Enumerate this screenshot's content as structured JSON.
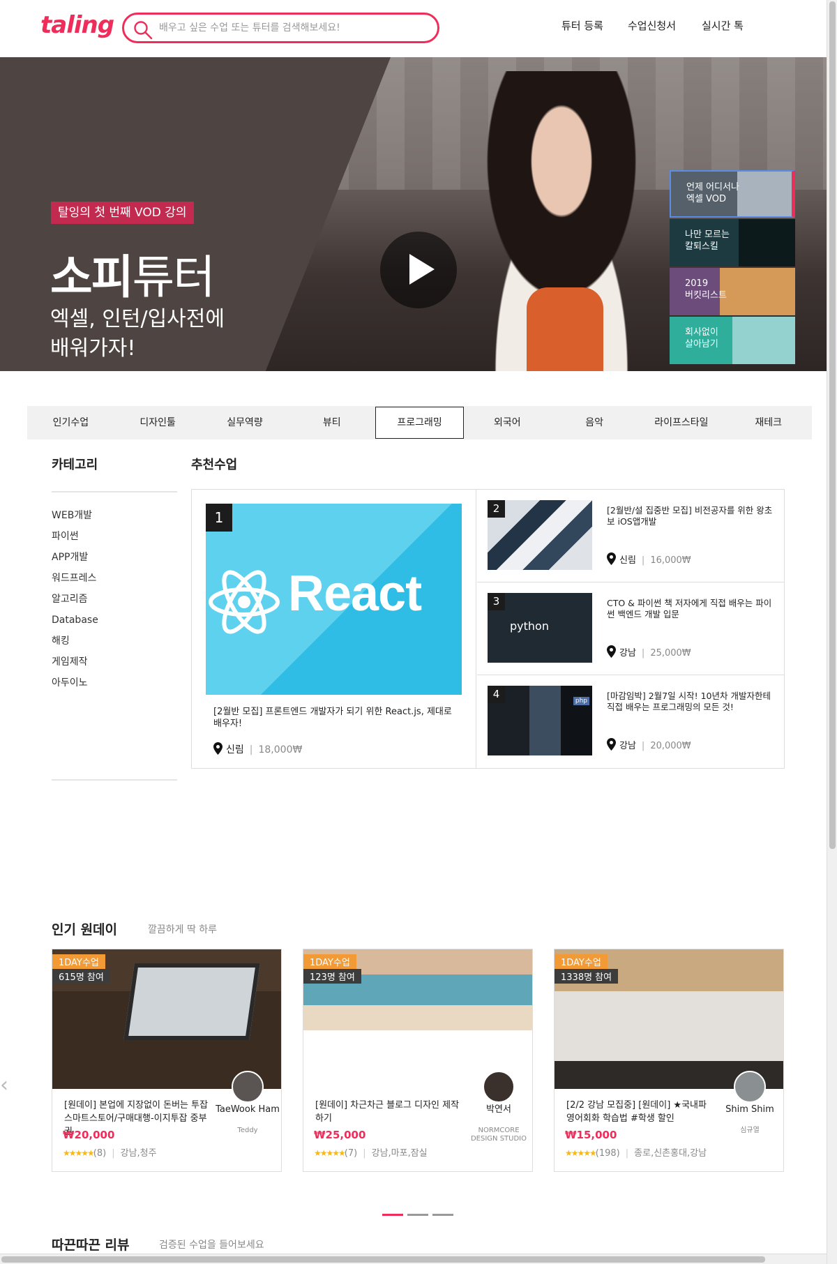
{
  "header": {
    "logo": "taling",
    "search_placeholder": "배우고 싶은 수업 또는 튜터를 검색해보세요!",
    "nav": [
      "튜터 등록",
      "수업신청서",
      "실시간 톡"
    ]
  },
  "hero": {
    "badge": "탈잉의 첫 번째 VOD 강의",
    "title_bold": "소피",
    "title_regular": "튜터",
    "subtitle": "엑셀, 인턴/입사전에\n배워가자!",
    "side_items": [
      "언제 어디서나\n엑셀 VOD",
      "나만 모르는\n칼퇴스킬",
      "2019\n버킷리스트",
      "회사없이\n살아남기"
    ]
  },
  "tabs": [
    "인기수업",
    "디자인툴",
    "실무역량",
    "뷰티",
    "프로그래밍",
    "외국어",
    "음악",
    "라이프스타일",
    "재테크"
  ],
  "active_tab": "프로그래밍",
  "sidebar": {
    "title": "카테고리",
    "items": [
      "WEB개발",
      "파이썬",
      "APP개발",
      "워드프레스",
      "알고리즘",
      "Database",
      "해킹",
      "게임제작",
      "아두이노"
    ]
  },
  "recommended": {
    "title": "추천수업",
    "items": [
      {
        "rank": "1",
        "image_text": "React",
        "title": "[2월반 모집] 프론트엔드 개발자가 되기 위한 React.js, 제대로 배우자!",
        "location": "신림",
        "price": "18,000₩"
      },
      {
        "rank": "2",
        "title": "[2월반/설 집중반 모집] 비전공자를 위한 왕초보 iOS앱개발",
        "location": "신림",
        "price": "16,000₩"
      },
      {
        "rank": "3",
        "image_text": "python",
        "title": "CTO & 파이썬 책 저자에게 직접 배우는 파이썬 백엔드 개발 입문",
        "location": "강남",
        "price": "25,000₩"
      },
      {
        "rank": "4",
        "image_text": "php",
        "title": "[마감임박] 2월7일 시작! 10년차 개발자한테 직접 배우는 프로그래밍의 모든 것!",
        "location": "강남",
        "price": "20,000₩"
      }
    ]
  },
  "popular": {
    "title": "인기 원데이",
    "subtitle": "깔끔하게 딱 하루",
    "cards": [
      {
        "tag": "1DAY수업",
        "participants": "615명 참여",
        "title": "[원데이] 본업에 지장없이 돈버는 투잡 스마트스토어/구매대행-이지투잡 중부권",
        "price": "₩20,000",
        "stars": "★★★★★",
        "reviews": "(8)",
        "areas": "강남,청주",
        "tutor": "TaeWook Ham",
        "tutor_sub": "Teddy"
      },
      {
        "tag": "1DAY수업",
        "participants": "123명 참여",
        "title": "[원데이] 차근차근 블로그 디자인 제작하기",
        "price": "₩25,000",
        "stars": "★★★★★",
        "reviews": "(7)",
        "areas": "강남,마포,잠실",
        "tutor": "박연서",
        "tutor_sub": "NORMCORE DESIGN STUDIO"
      },
      {
        "tag": "1DAY수업",
        "participants": "1338명 참여",
        "title": "[2/2 강남 모집중] [원데이] ★국내파 영어회화 학습법 #학생 할인",
        "price": "₩15,000",
        "stars": "★★★★★",
        "reviews": "(198)",
        "areas": "종로,신촌홍대,강남",
        "tutor": "Shim Shim",
        "tutor_sub": "심규열"
      }
    ]
  },
  "review": {
    "title": "따끈따끈 리뷰",
    "subtitle": "검증된 수업을 들어보세요"
  },
  "colors": {
    "brand": "#ee2d5a",
    "badge": "#c32a4f",
    "tag_orange": "#f19a36"
  }
}
